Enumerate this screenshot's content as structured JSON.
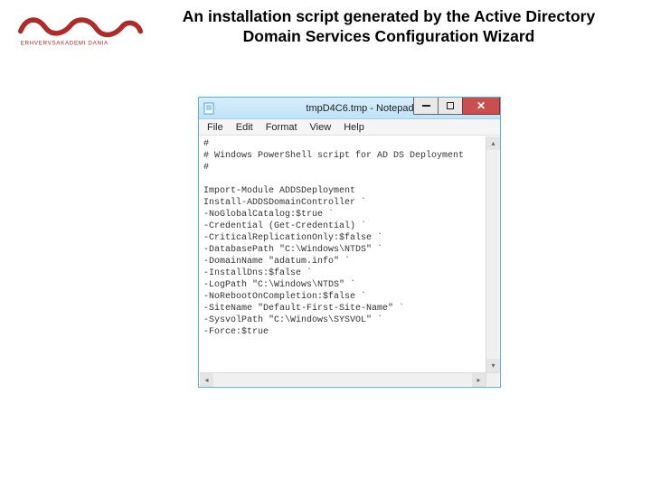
{
  "logo": {
    "subtext": "ERHVERVSAKADEMI DANIA"
  },
  "slide": {
    "title": "An installation script generated by the Active Directory Domain Services Configuration Wizard"
  },
  "window": {
    "title": "tmpD4C6.tmp - Notepad",
    "menus": {
      "file": "File",
      "edit": "Edit",
      "format": "Format",
      "view": "View",
      "help": "Help"
    },
    "content": "#\n# Windows PowerShell script for AD DS Deployment\n#\n\nImport-Module ADDSDeployment\nInstall-ADDSDomainController `\n-NoGlobalCatalog:$true `\n-Credential (Get-Credential) `\n-CriticalReplicationOnly:$false `\n-DatabasePath \"C:\\Windows\\NTDS\" `\n-DomainName \"adatum.info\" `\n-InstallDns:$false `\n-LogPath \"C:\\Windows\\NTDS\" `\n-NoRebootOnCompletion:$false `\n-SiteName \"Default-First-Site-Name\" `\n-SysvolPath \"C:\\Windows\\SYSVOL\" `\n-Force:$true"
  }
}
